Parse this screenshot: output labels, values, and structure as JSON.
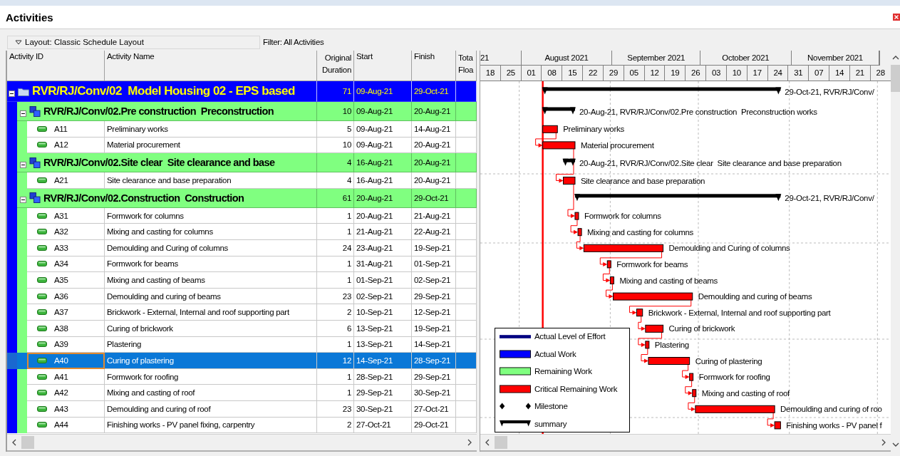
{
  "panel": {
    "title": "Activities"
  },
  "layout_bar": {
    "layout": "Layout: Classic Schedule Layout",
    "filter": "Filter: All Activities"
  },
  "columns": [
    {
      "label": "Activity ID"
    },
    {
      "label": "Activity Name"
    },
    {
      "label": "Original Duration"
    },
    {
      "label": "Start"
    },
    {
      "label": "Finish"
    },
    {
      "label": "Tota Floa"
    }
  ],
  "timeline": {
    "months": [
      "21",
      "August 2021",
      "September 2021",
      "October 2021",
      "November 2021"
    ],
    "weeks": [
      "18",
      "25",
      "01",
      "08",
      "15",
      "22",
      "29",
      "05",
      "12",
      "19",
      "26",
      "03",
      "10",
      "17",
      "24",
      "31",
      "07",
      "14",
      "21",
      "28"
    ]
  },
  "rows": [
    {
      "kind": "project",
      "expanded": true,
      "name": "RVR/RJ/Conv/02  Model Housing 02 - EPS based",
      "duration": "71",
      "start": "09-Aug-21",
      "finish": "29-Oct-21",
      "bar_label": "29-Oct-21, RVR/RJ/Conv/",
      "children": [
        {
          "kind": "wbs",
          "expanded": true,
          "name": "RVR/RJ/Conv/02.Pre construction  Preconstruction",
          "duration": "10",
          "start": "09-Aug-21",
          "finish": "20-Aug-21",
          "bar_label": "20-Aug-21, RVR/RJ/Conv/02.Pre construction  Preconstruction works",
          "children": [
            {
              "kind": "activity",
              "selected": false,
              "id": "A11",
              "name": "Preliminary works",
              "duration": "5",
              "start": "09-Aug-21",
              "finish": "14-Aug-21",
              "bar_label": "Preliminary works"
            },
            {
              "kind": "activity",
              "selected": false,
              "id": "A12",
              "name": "Material procurement",
              "duration": "10",
              "start": "09-Aug-21",
              "finish": "20-Aug-21",
              "bar_label": "Material procurement"
            }
          ]
        },
        {
          "kind": "wbs",
          "expanded": true,
          "name": "RVR/RJ/Conv/02.Site clear  Site clearance and base",
          "duration": "4",
          "start": "16-Aug-21",
          "finish": "20-Aug-21",
          "bar_label": "20-Aug-21, RVR/RJ/Conv/02.Site clear  Site clearance and base preparation",
          "children": [
            {
              "kind": "activity",
              "selected": false,
              "id": "A21",
              "name": "Site clearance and base preparation",
              "duration": "4",
              "start": "16-Aug-21",
              "finish": "20-Aug-21",
              "bar_label": "Site clearance and base preparation"
            }
          ]
        },
        {
          "kind": "wbs",
          "expanded": true,
          "name": "RVR/RJ/Conv/02.Construction  Construction",
          "duration": "61",
          "start": "20-Aug-21",
          "finish": "29-Oct-21",
          "bar_label": "29-Oct-21, RVR/RJ/Conv/",
          "children": [
            {
              "kind": "activity",
              "selected": false,
              "id": "A31",
              "name": "Formwork for columns",
              "duration": "1",
              "start": "20-Aug-21",
              "finish": "21-Aug-21",
              "bar_label": "Formwork for columns"
            },
            {
              "kind": "activity",
              "selected": false,
              "id": "A32",
              "name": "Mixing and casting for columns",
              "duration": "1",
              "start": "21-Aug-21",
              "finish": "22-Aug-21",
              "bar_label": "Mixing and casting for columns"
            },
            {
              "kind": "activity",
              "selected": false,
              "id": "A33",
              "name": "Demoulding and Curing of columns",
              "duration": "24",
              "start": "23-Aug-21",
              "finish": "19-Sep-21",
              "bar_label": "Demoulding and Curing of columns"
            },
            {
              "kind": "activity",
              "selected": false,
              "id": "A34",
              "name": "Formwork for beams",
              "duration": "1",
              "start": "31-Aug-21",
              "finish": "01-Sep-21",
              "bar_label": "Formwork for beams"
            },
            {
              "kind": "activity",
              "selected": false,
              "id": "A35",
              "name": "Mixing and casting of beams",
              "duration": "1",
              "start": "01-Sep-21",
              "finish": "02-Sep-21",
              "bar_label": "Mixing and casting of beams"
            },
            {
              "kind": "activity",
              "selected": false,
              "id": "A36",
              "name": "Demoulding and curing of beams",
              "duration": "23",
              "start": "02-Sep-21",
              "finish": "29-Sep-21",
              "bar_label": "Demoulding and curing of beams"
            },
            {
              "kind": "activity",
              "selected": false,
              "id": "A37",
              "name": "Brickwork - External, Internal and roof supporting part",
              "duration": "2",
              "start": "10-Sep-21",
              "finish": "12-Sep-21",
              "bar_label": "Brickwork - External, Internal and roof supporting part"
            },
            {
              "kind": "activity",
              "selected": false,
              "id": "A38",
              "name": "Curing of brickwork",
              "duration": "6",
              "start": "13-Sep-21",
              "finish": "19-Sep-21",
              "bar_label": "Curing of brickwork"
            },
            {
              "kind": "activity",
              "selected": false,
              "id": "A39",
              "name": "Plastering",
              "duration": "1",
              "start": "13-Sep-21",
              "finish": "14-Sep-21",
              "bar_label": "Plastering"
            },
            {
              "kind": "activity",
              "selected": true,
              "id": "A40",
              "name": "Curing of plastering",
              "duration": "12",
              "start": "14-Sep-21",
              "finish": "28-Sep-21",
              "bar_label": "Curing of plastering"
            },
            {
              "kind": "activity",
              "selected": false,
              "id": "A41",
              "name": "Formwork for roofing",
              "duration": "1",
              "start": "28-Sep-21",
              "finish": "29-Sep-21",
              "bar_label": "Formwork for roofing"
            },
            {
              "kind": "activity",
              "selected": false,
              "id": "A42",
              "name": "Mixing and casting of roof",
              "duration": "1",
              "start": "29-Sep-21",
              "finish": "30-Sep-21",
              "bar_label": "Mixing and casting of roof"
            },
            {
              "kind": "activity",
              "selected": false,
              "id": "A43",
              "name": "Demoulding and curing of roof",
              "duration": "23",
              "start": "30-Sep-21",
              "finish": "27-Oct-21",
              "bar_label": "Demoulding and curing of roo"
            },
            {
              "kind": "activity",
              "selected": false,
              "id": "A44",
              "name": "Finishing works - PV panel fixing, carpentry",
              "duration": "2",
              "start": "27-Oct-21",
              "finish": "29-Oct-21",
              "bar_label": "Finishing works - PV panel f"
            }
          ]
        }
      ]
    }
  ],
  "legend": [
    {
      "kind": "line",
      "label": "Actual Level of Effort",
      "color": "#000080"
    },
    {
      "kind": "bar",
      "label": "Actual Work",
      "color": "#0000ff"
    },
    {
      "kind": "bar",
      "label": "Remaining Work",
      "color": "#80ff80"
    },
    {
      "kind": "bar",
      "label": "Critical Remaining Work",
      "color": "#ff0000"
    },
    {
      "kind": "milestone",
      "label": "Milestone"
    },
    {
      "kind": "summary",
      "label": "summary"
    }
  ]
}
